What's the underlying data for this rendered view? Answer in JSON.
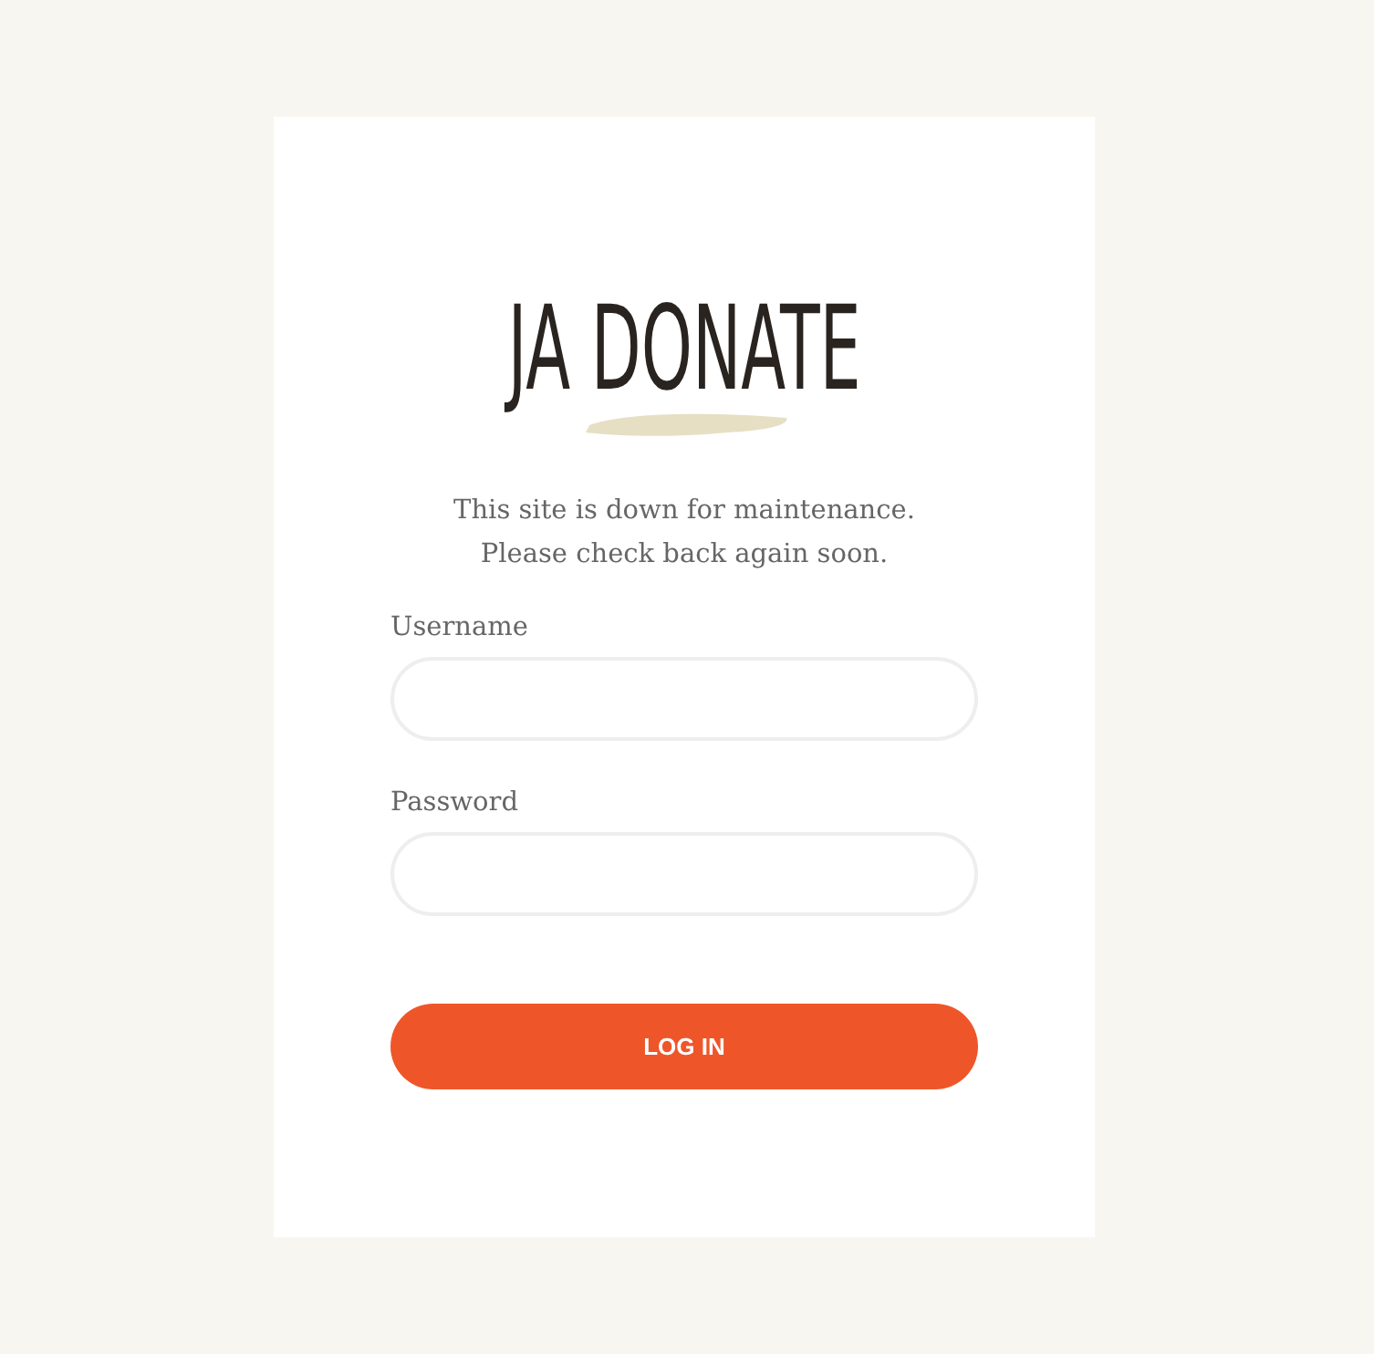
{
  "logo": {
    "text": "JA DONATE"
  },
  "message": [
    "This site is down for maintenance.",
    "Please check back again soon."
  ],
  "fields": [
    {
      "label": "Username"
    },
    {
      "label": "Password"
    }
  ],
  "button": {
    "label": "LOG IN"
  }
}
